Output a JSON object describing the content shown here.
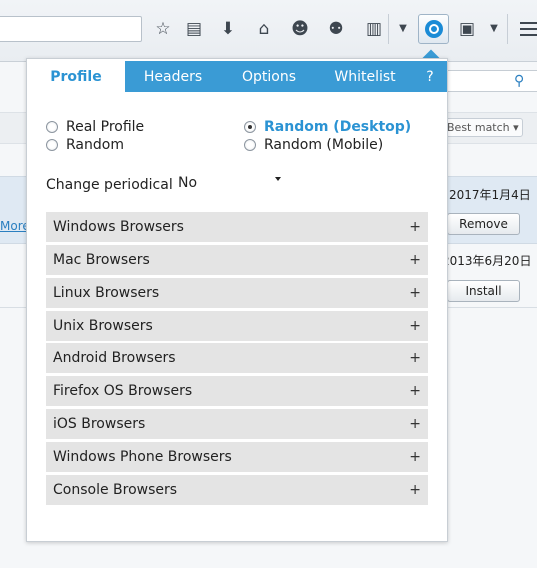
{
  "toolbar": {
    "url_value": "",
    "icons": [
      "star-icon",
      "reading-list-icon",
      "download-icon",
      "home-icon",
      "emoji-icon",
      "extension-icon",
      "clipboard-icon",
      "dropdown-icon",
      "user-agent-icon",
      "addon-icon",
      "dropdown-icon",
      "menu-icon"
    ]
  },
  "background": {
    "sort_label": "Best match ▾",
    "more_link": "More",
    "row1": {
      "date": "2017年1月4日",
      "button": "Remove"
    },
    "row2": {
      "date": "2013年6月20日",
      "button": "Install"
    }
  },
  "panel": {
    "tabs": [
      {
        "label": "Profile",
        "active": true
      },
      {
        "label": "Headers",
        "active": false
      },
      {
        "label": "Options",
        "active": false
      },
      {
        "label": "Whitelist",
        "active": false
      },
      {
        "label": "?",
        "active": false
      }
    ],
    "profile_options": [
      {
        "label": "Real Profile",
        "checked": false
      },
      {
        "label": "Random",
        "checked": false
      },
      {
        "label": "Random (Desktop)",
        "checked": true
      },
      {
        "label": "Random (Mobile)",
        "checked": false
      }
    ],
    "periodic": {
      "label": "Change periodically:",
      "value": "No"
    },
    "groups": [
      {
        "label": "Windows Browsers",
        "toggle": "+"
      },
      {
        "label": "Mac Browsers",
        "toggle": "+"
      },
      {
        "label": "Linux Browsers",
        "toggle": "+"
      },
      {
        "label": "Unix Browsers",
        "toggle": "+"
      },
      {
        "label": "Android Browsers",
        "toggle": "+"
      },
      {
        "label": "Firefox OS Browsers",
        "toggle": "+"
      },
      {
        "label": "iOS Browsers",
        "toggle": "+"
      },
      {
        "label": "Windows Phone Browsers",
        "toggle": "+"
      },
      {
        "label": "Console Browsers",
        "toggle": "+"
      }
    ]
  },
  "colors": {
    "accent": "#3a9bd5",
    "group_bg": "#e4e4e4"
  }
}
